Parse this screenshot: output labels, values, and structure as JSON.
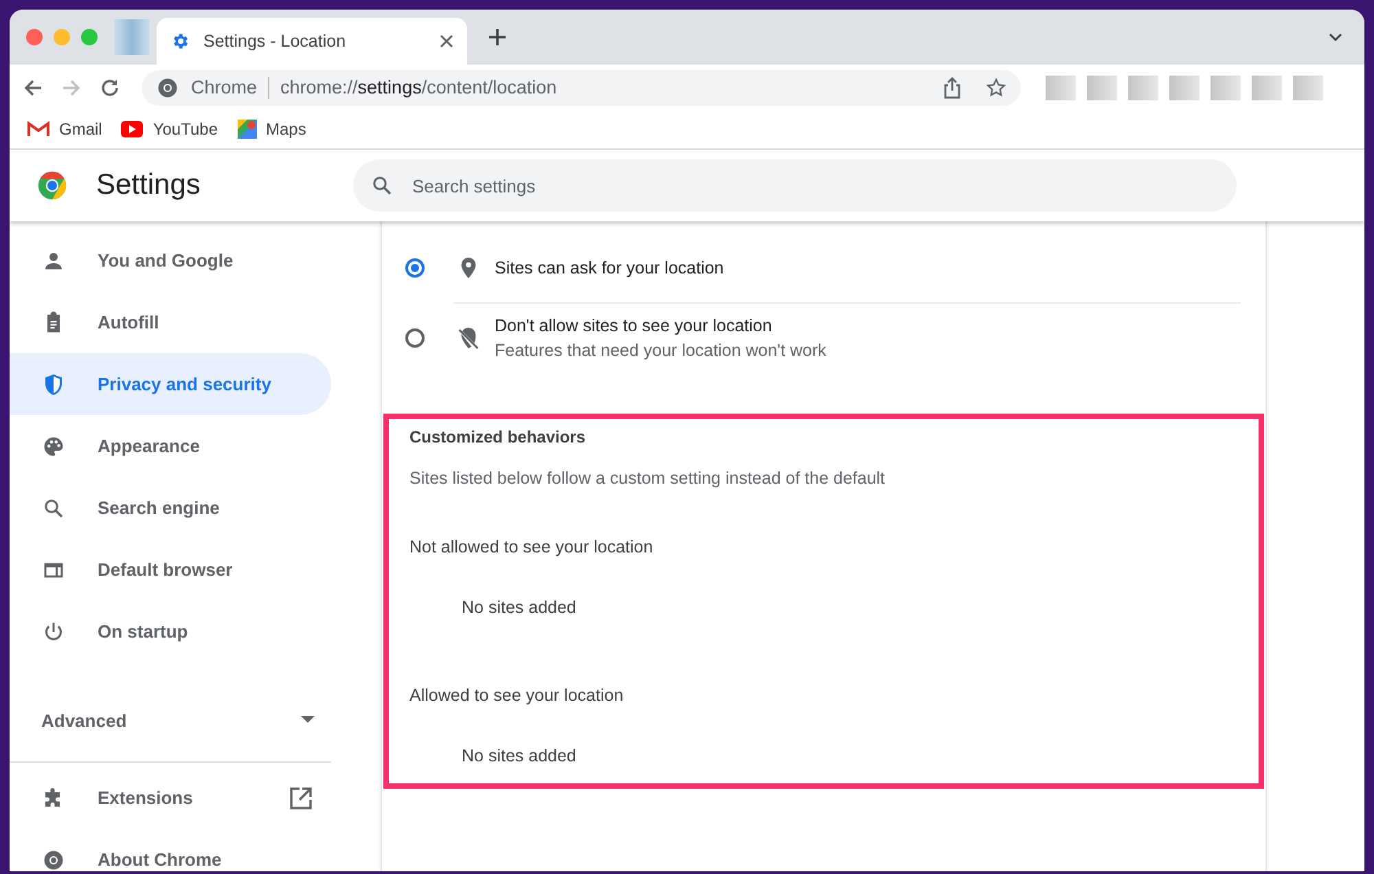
{
  "tabs": [
    {
      "title": "Settings - Location",
      "selected": true
    }
  ],
  "toolbar": {
    "origin_label": "Chrome",
    "url": {
      "scheme": "chrome://",
      "host": "settings",
      "path": "/content/location"
    }
  },
  "bookmarks": [
    {
      "kind": "gmail",
      "label": "Gmail"
    },
    {
      "kind": "youtube",
      "label": "YouTube"
    },
    {
      "kind": "maps",
      "label": "Maps"
    }
  ],
  "header": {
    "title": "Settings",
    "search": {
      "placeholder": "Search settings"
    }
  },
  "sidebar": {
    "items": [
      {
        "kind": "person",
        "label": "You and Google",
        "selected": false
      },
      {
        "kind": "clipboard",
        "label": "Autofill",
        "selected": false
      },
      {
        "kind": "shield",
        "label": "Privacy and security",
        "selected": true
      },
      {
        "kind": "palette",
        "label": "Appearance",
        "selected": false
      },
      {
        "kind": "search",
        "label": "Search engine",
        "selected": false
      },
      {
        "kind": "browser",
        "label": "Default browser",
        "selected": false
      },
      {
        "kind": "power",
        "label": "On startup",
        "selected": false
      }
    ],
    "advanced": {
      "label": "Advanced",
      "expanded": false
    },
    "footer_items": [
      {
        "kind": "puzzle",
        "label": "Extensions",
        "external": true
      },
      {
        "kind": "chrome",
        "label": "About Chrome",
        "external": false
      }
    ]
  },
  "location_options": [
    {
      "kind": "pin",
      "label": "Sites can ask for your location",
      "selected": true
    },
    {
      "kind": "pin-off",
      "label": "Don't allow sites to see your location",
      "description": "Features that need your location won't work",
      "selected": false
    }
  ],
  "customized": {
    "title": "Customized behaviors",
    "subtitle": "Sites listed below follow a custom setting instead of the default",
    "groups": [
      {
        "title": "Not allowed to see your location",
        "empty_text": "No sites added"
      },
      {
        "title": "Allowed to see your location",
        "empty_text": "No sites added"
      }
    ]
  }
}
